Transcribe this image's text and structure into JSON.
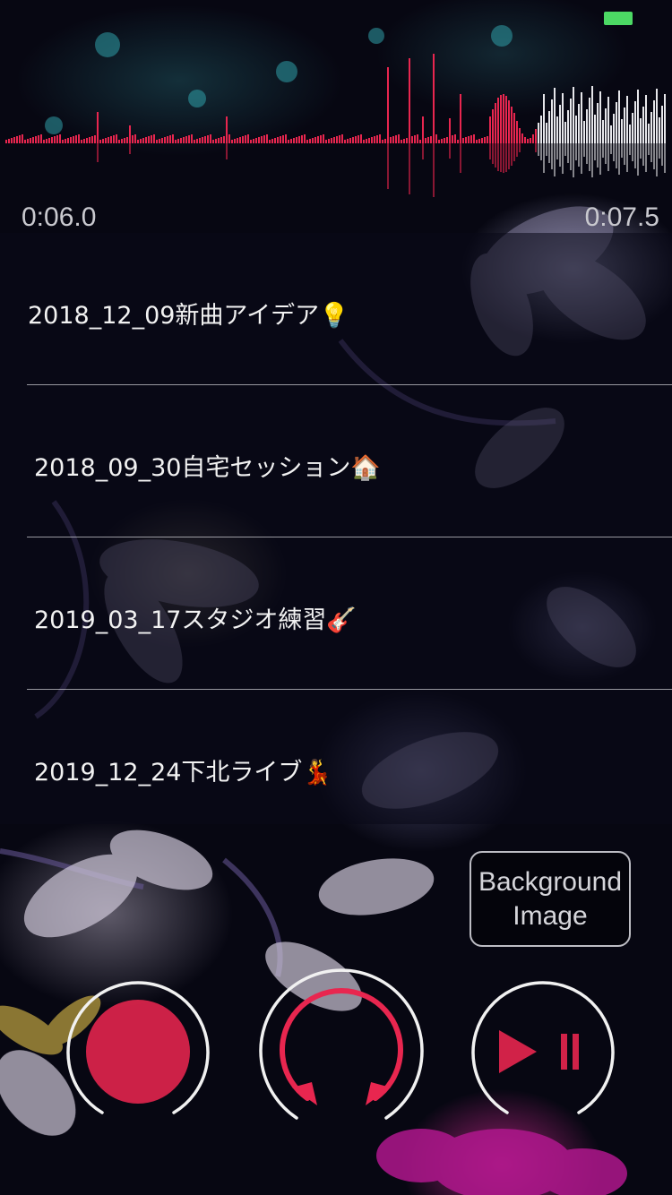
{
  "status_bar": {
    "battery_color": "#4cd964"
  },
  "player": {
    "current_time": "0:06.0",
    "total_time": "0:07.5",
    "accent_color": "#e8264f"
  },
  "recordings": [
    {
      "title": "2018_12_09新曲アイデア💡"
    },
    {
      "title": "2018_09_30自宅セッション🏠"
    },
    {
      "title": "2019_03_17スタジオ練習🎸"
    },
    {
      "title": "2019_12_24下北ライブ💃"
    }
  ],
  "buttons": {
    "background_image_line1": "Background",
    "background_image_line2": "Image",
    "record_icon": "record-icon",
    "loop_icon": "loop-icon",
    "play_pause_icon": "play-pause-icon"
  }
}
